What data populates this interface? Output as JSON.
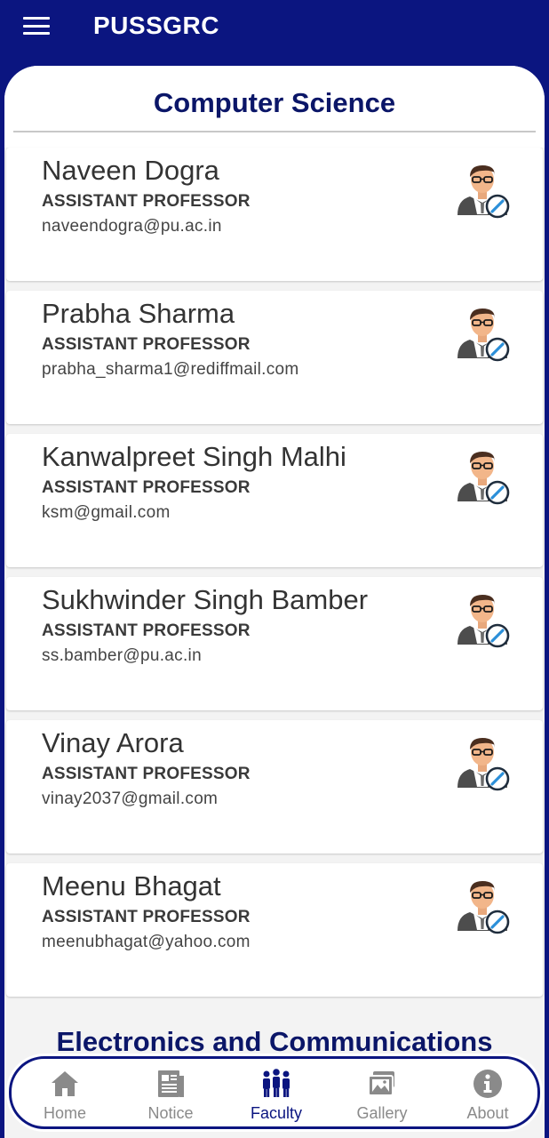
{
  "app": {
    "title": "PUSSGRC"
  },
  "departments": [
    {
      "title": "Computer Science",
      "faculty": [
        {
          "name": "Naveen Dogra",
          "role": "ASSISTANT PROFESSOR",
          "email": "naveendogra@pu.ac.in"
        },
        {
          "name": "Prabha Sharma",
          "role": "ASSISTANT PROFESSOR",
          "email": "prabha_sharma1@rediffmail.com"
        },
        {
          "name": "Kanwalpreet Singh Malhi",
          "role": "ASSISTANT PROFESSOR",
          "email": "ksm@gmail.com"
        },
        {
          "name": "Sukhwinder Singh Bamber",
          "role": "ASSISTANT PROFESSOR",
          "email": "ss.bamber@pu.ac.in"
        },
        {
          "name": "Vinay Arora",
          "role": "ASSISTANT PROFESSOR",
          "email": "vinay2037@gmail.com"
        },
        {
          "name": "Meenu Bhagat",
          "role": "ASSISTANT PROFESSOR",
          "email": "meenubhagat@yahoo.com"
        }
      ]
    },
    {
      "title": "Electronics and Communications"
    }
  ],
  "nav": {
    "active": "Faculty",
    "items": [
      {
        "label": "Home",
        "icon": "home-icon"
      },
      {
        "label": "Notice",
        "icon": "newspaper-icon"
      },
      {
        "label": "Faculty",
        "icon": "people-icon"
      },
      {
        "label": "Gallery",
        "icon": "gallery-icon"
      },
      {
        "label": "About",
        "icon": "info-icon"
      }
    ]
  },
  "colors": {
    "primary": "#0b1580",
    "heading": "#0b1668",
    "inactive": "#8a8a8a"
  }
}
